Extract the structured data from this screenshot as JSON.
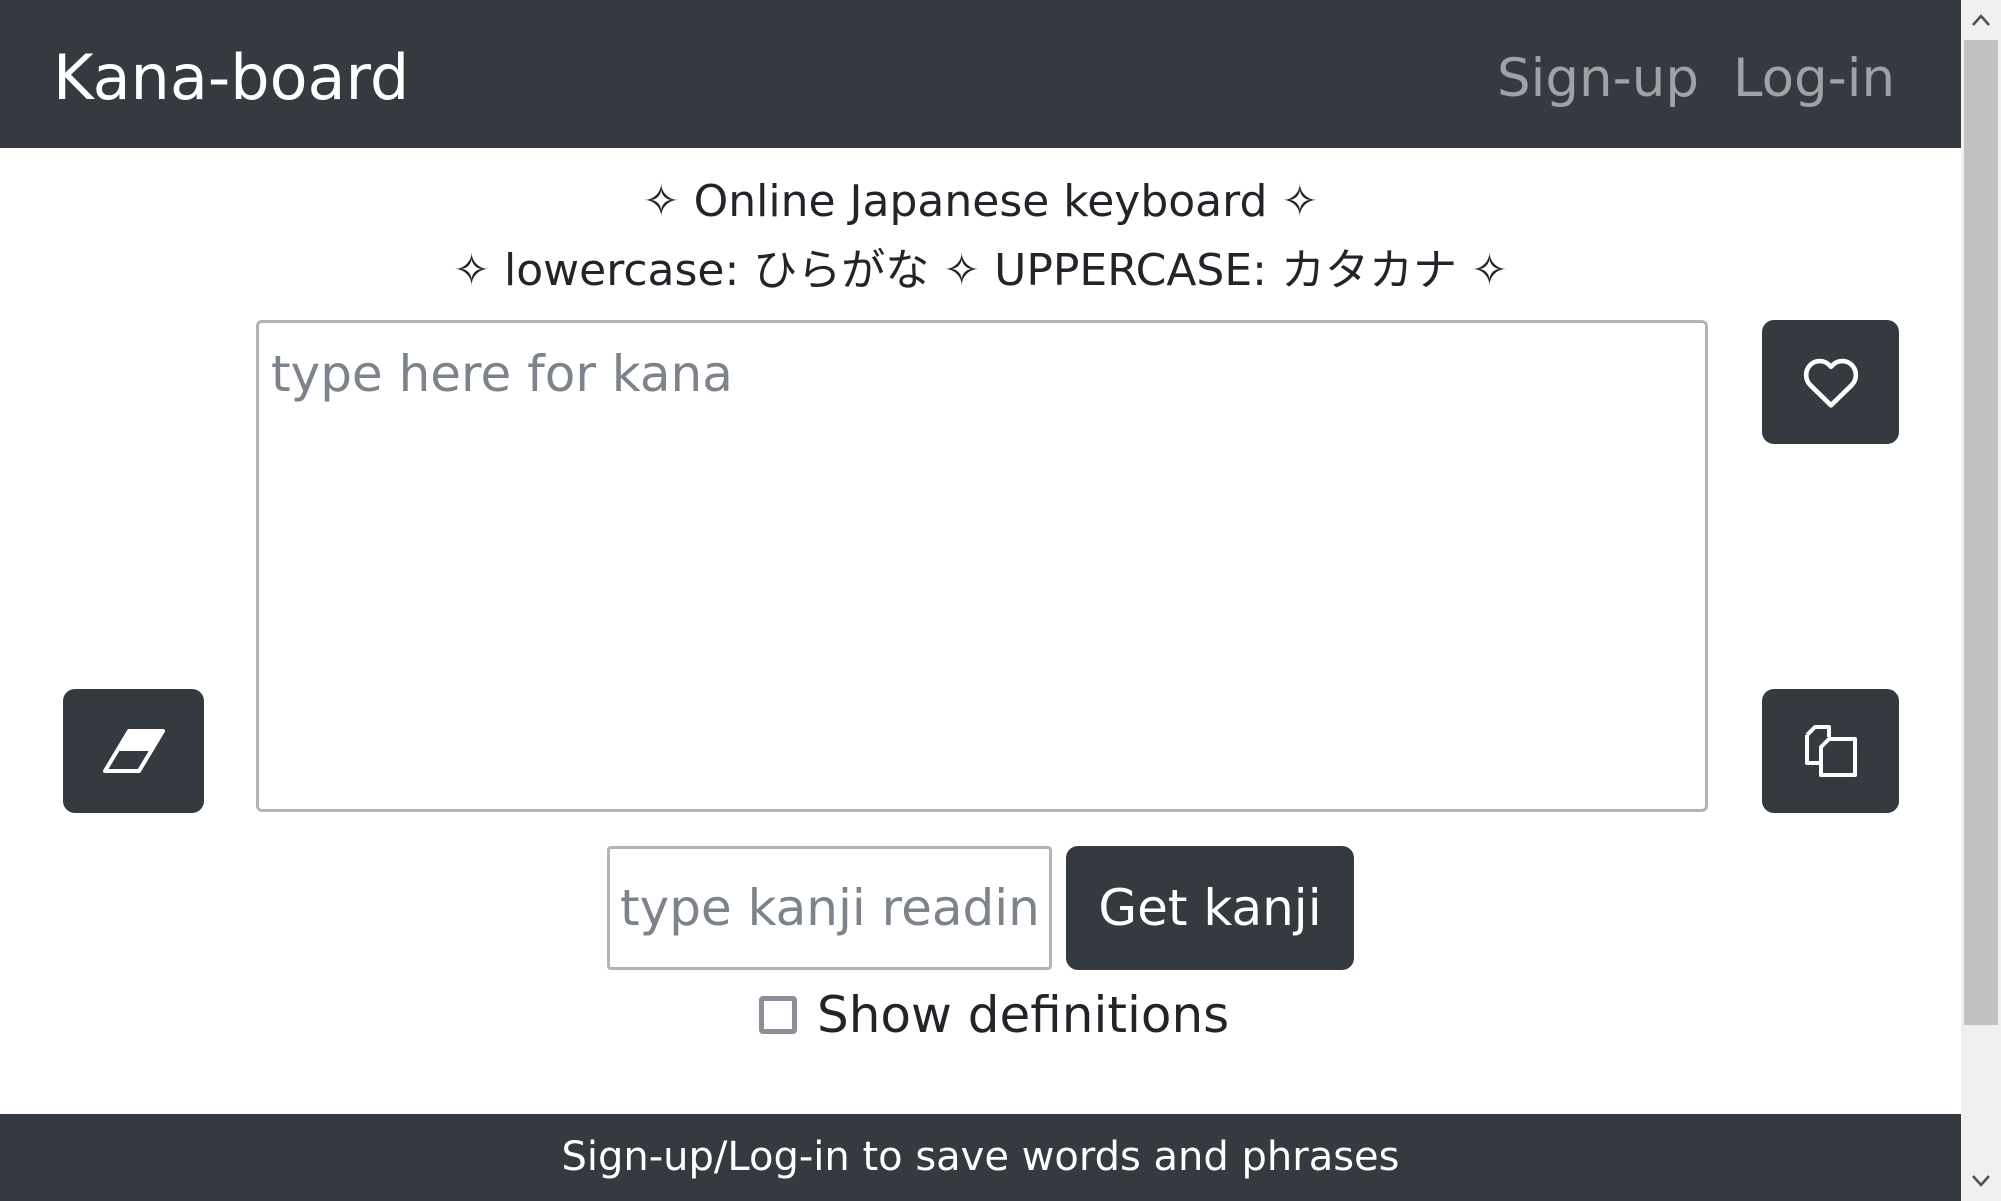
{
  "navbar": {
    "brand": "Kana-board",
    "signup": "Sign-up",
    "login": "Log-in",
    "bg_color": "#343a40"
  },
  "header": {
    "tagline_1": "✧ Online Japanese keyboard ✧",
    "tagline_2": "✧ lowercase: ひらがな ✧ UPPERCASE: カタカナ ✧"
  },
  "editor": {
    "placeholder": "type here for kana",
    "value": ""
  },
  "buttons": {
    "favorite_icon": "heart-icon",
    "copy_icon": "copy-icon",
    "clear_icon": "eraser-icon"
  },
  "kanji": {
    "placeholder": "type kanji reading",
    "button_label": "Get kanji"
  },
  "definitions": {
    "label": "Show definitions",
    "checked": false
  },
  "footer": {
    "text": "Sign-up/Log-in to save words and phrases"
  }
}
